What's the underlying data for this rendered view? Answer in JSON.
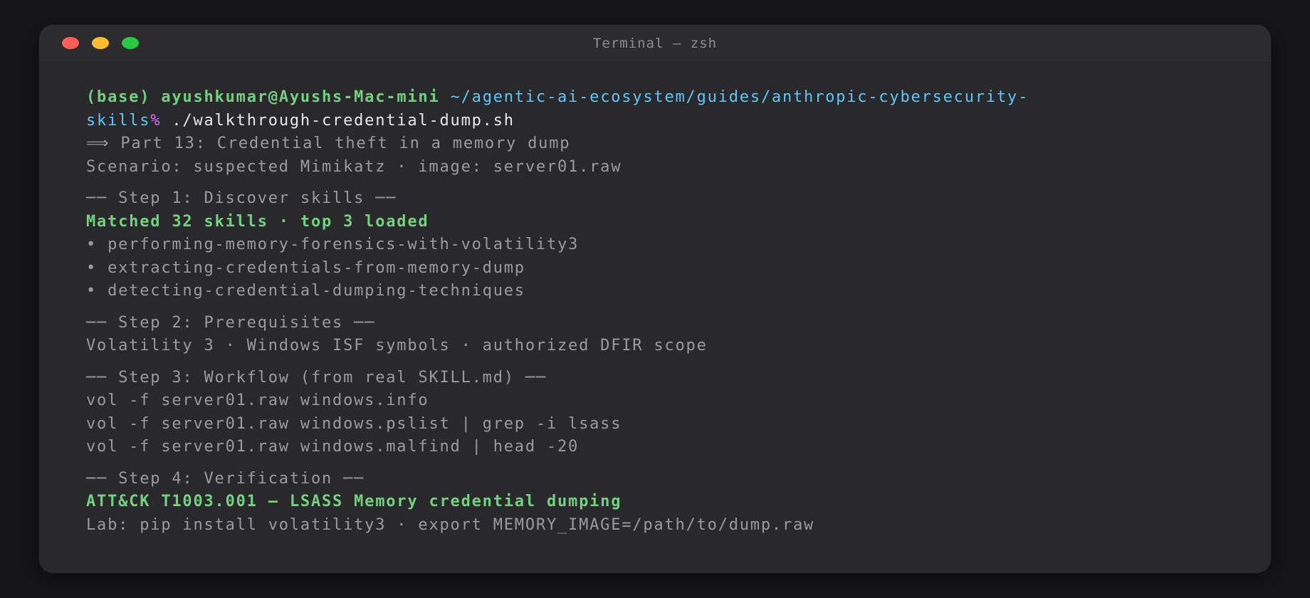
{
  "window": {
    "title": "Terminal — zsh"
  },
  "prompt": {
    "env": "(base)",
    "user_host": "ayushkumar@Ayushs-Mac-mini",
    "path_line1": "~/agentic-ai-ecosystem/guides/anthropic-cybersecurity-",
    "path_line2": "skills",
    "symbol": "%",
    "command": " ./walkthrough-credential-dump.sh"
  },
  "output": {
    "part_title": "⟹ Part 13: Credential theft in a memory dump",
    "scenario": "Scenario: suspected Mimikatz · image: server01.raw",
    "step1": {
      "header": "── Step 1: Discover skills ──",
      "matched": "Matched 32 skills · top 3 loaded",
      "skills": [
        "• performing-memory-forensics-with-volatility3",
        "• extracting-credentials-from-memory-dump",
        "• detecting-credential-dumping-techniques"
      ]
    },
    "step2": {
      "header": "── Step 2: Prerequisites ──",
      "text": "Volatility 3 · Windows ISF symbols · authorized DFIR scope"
    },
    "step3": {
      "header": "── Step 3: Workflow (from real SKILL.md) ──",
      "commands": [
        "vol -f server01.raw windows.info",
        "vol -f server01.raw windows.pslist | grep -i lsass",
        "vol -f server01.raw windows.malfind | head -20"
      ]
    },
    "step4": {
      "header": "── Step 4: Verification ──",
      "attack": "ATT&CK T1003.001 — LSASS Memory credential dumping",
      "lab": "Lab: pip install volatility3 · export MEMORY_IMAGE=/path/to/dump.raw"
    }
  },
  "colors": {
    "background": "#161619",
    "window": "#29292c",
    "prompt_cyan": "#5ac8fa",
    "success_green": "#72d17e",
    "dim_grey": "#9a9aa0",
    "prompt_symbol": "#d570f0",
    "close": "#ff5f57",
    "minimize": "#febc2e",
    "zoom": "#28c840"
  }
}
